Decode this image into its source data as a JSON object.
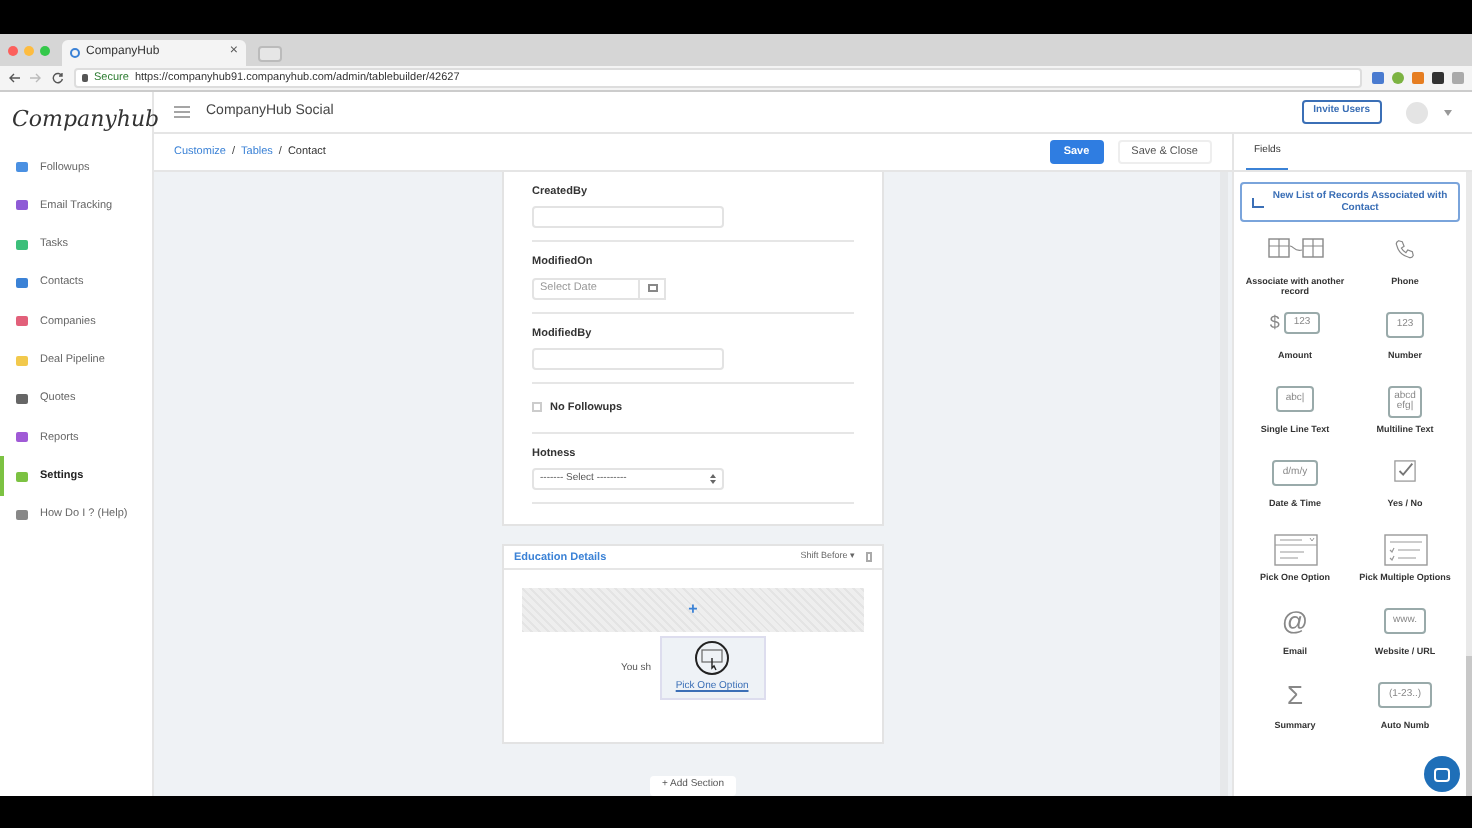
{
  "browser": {
    "tab_title": "CompanyHub",
    "tab_close": "×",
    "secure": "Secure",
    "url": "https://companyhub91.companyhub.com/admin/tablebuilder/42627"
  },
  "sidebar": {
    "logo": "Companyhub",
    "items": [
      {
        "label": "Followups",
        "color": "#4a90e2",
        "selected": false
      },
      {
        "label": "Email Tracking",
        "color": "#8e5bd6",
        "selected": false
      },
      {
        "label": "Tasks",
        "color": "#3cbf7a",
        "selected": false
      },
      {
        "label": "Contacts",
        "color": "#3b82d6",
        "selected": false
      },
      {
        "label": "Companies",
        "color": "#e2607a",
        "selected": false
      },
      {
        "label": "Deal Pipeline",
        "color": "#f2c94c",
        "selected": false
      },
      {
        "label": "Quotes",
        "color": "#666666",
        "selected": false
      },
      {
        "label": "Reports",
        "color": "#a05ad6",
        "selected": false
      },
      {
        "label": "Settings",
        "color": "#7cc242",
        "selected": true
      },
      {
        "label": "How Do I ? (Help)",
        "color": "#888888",
        "selected": false
      }
    ]
  },
  "header": {
    "title": "CompanyHub Social",
    "invite_button": "Invite Users"
  },
  "breadcrumb_separator": "/",
  "breadcrumb": [
    {
      "label": "Customize",
      "kind": "link"
    },
    {
      "label": "Tables",
      "kind": "link"
    },
    {
      "label": "Contact",
      "kind": "current"
    }
  ],
  "actions": {
    "save": "Save",
    "save_close": "Save & Close"
  },
  "form": {
    "fields": [
      {
        "kind": "text",
        "label": "CreatedBy"
      },
      {
        "kind": "date",
        "label": "ModifiedOn",
        "placeholder": "Select Date"
      },
      {
        "kind": "text",
        "label": "ModifiedBy"
      },
      {
        "kind": "checkbox",
        "label": "No Followups",
        "checked": false
      },
      {
        "kind": "select",
        "label": "Hotness",
        "value": "------- Select ---------"
      }
    ]
  },
  "section": {
    "title": "Education Details",
    "shift": "Shift Before ▾",
    "dragged_field": "Pick One Option",
    "hint": "You sh",
    "plus": "+"
  },
  "add_section": "+ Add Section",
  "fields_panel": {
    "tab": "Fields",
    "tab_selected": true,
    "new_list": "New List of Records Associated with Contact",
    "items": [
      {
        "label": "Associate with another record",
        "kind": "associate"
      },
      {
        "label": "Phone",
        "kind": "phone"
      },
      {
        "label": "Amount",
        "kind": "amount",
        "prefix": "$",
        "icon_text": "123"
      },
      {
        "label": "Number",
        "kind": "box",
        "icon_text": "123"
      },
      {
        "label": "Single Line Text",
        "kind": "box",
        "icon_text": "abc|"
      },
      {
        "label": "Multiline Text",
        "kind": "box2",
        "icon_text": "abcd",
        "icon_text2": "efg|"
      },
      {
        "label": "Date & Time",
        "kind": "box",
        "icon_text": "d/m/y"
      },
      {
        "label": "Yes / No",
        "kind": "check"
      },
      {
        "label": "Pick One Option",
        "kind": "pickone"
      },
      {
        "label": "Pick Multiple Options",
        "kind": "pickmulti"
      },
      {
        "label": "Email",
        "kind": "at",
        "icon_text": "@"
      },
      {
        "label": "Website / URL",
        "kind": "box",
        "icon_text": "www."
      },
      {
        "label": "Summary",
        "kind": "sigma",
        "icon_text": "Σ"
      },
      {
        "label": "Auto Numb",
        "kind": "box",
        "icon_text": "(1-23..)"
      }
    ]
  }
}
